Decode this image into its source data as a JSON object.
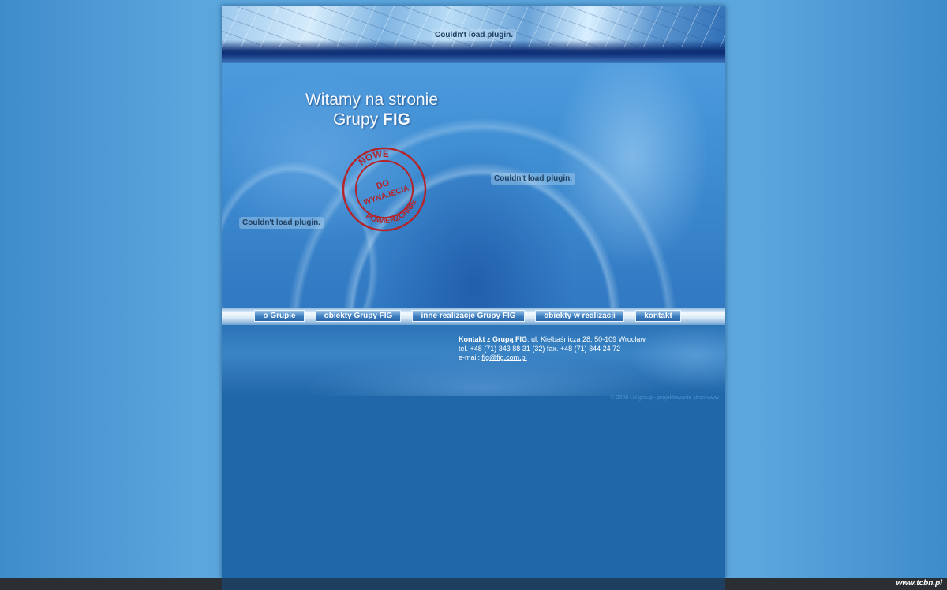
{
  "plugins": {
    "header_msg": "Couldn't load plugin.",
    "hero_right_msg": "Couldn't load plugin.",
    "hero_left_msg": "Couldn't load plugin."
  },
  "hero": {
    "welcome_line1": "Witamy na stronie",
    "welcome_line2_prefix": "Grupy",
    "welcome_line2_bold": "FIG",
    "stamp": {
      "top_text": "NOWE",
      "center_line1": "DO",
      "center_line2": "WYNAJĘCIA",
      "bottom_text": "POWIERZCHNIE",
      "color": "#b3252b"
    }
  },
  "nav": {
    "items": [
      {
        "label": "o Grupie"
      },
      {
        "label": "obiekty Grupy FIG"
      },
      {
        "label": "inne realizacje Grupy FIG"
      },
      {
        "label": "obiekty w realizacji"
      },
      {
        "label": "kontakt"
      }
    ]
  },
  "contact": {
    "heading": "Kontakt z Grupą FIG",
    "address": ": ul. Kiełbaśnicza 28, 50-109 Wrocław",
    "phone_line": "tel. +48 (71) 343 88 31 (32) fax. +48 (71) 344 24 72",
    "email_label": "e-mail: ",
    "email": "fig@fig.com.pl"
  },
  "footer": {
    "copyright": "© 2009 LN group - projektowanie stron www",
    "watermark": "www.tcbn.pl"
  },
  "colors": {
    "page_bg": "#5aa6dd",
    "content_bg": "#1f67a8",
    "stamp_red": "#b3252b"
  }
}
